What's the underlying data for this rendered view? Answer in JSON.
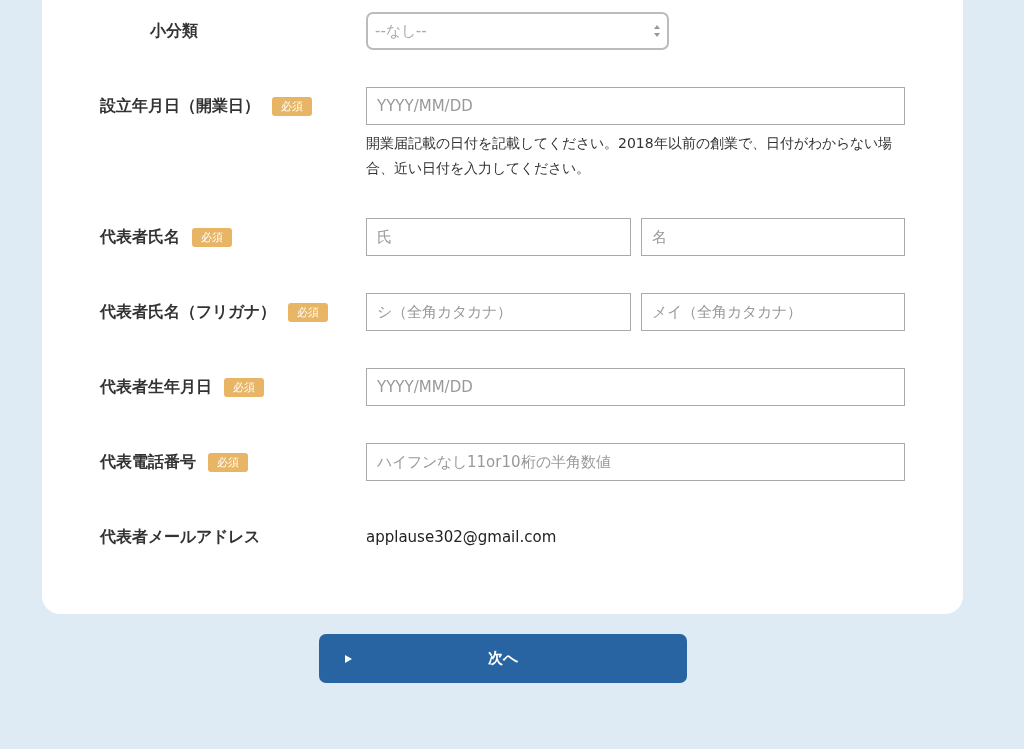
{
  "form": {
    "rows": [
      {
        "kind": "select",
        "label": "小分類",
        "value": "--なし--"
      },
      {
        "kind": "text",
        "label": "設立年月日（開業日）",
        "badge": "必須",
        "placeholder": "YYYY/MM/DD",
        "help": "開業届記載の日付を記載してください。2018年以前の創業で、日付がわからない場合、近い日付を入力してください。"
      },
      {
        "kind": "pair",
        "label": "代表者氏名",
        "badge": "必須",
        "placeholders": [
          "氏",
          "名"
        ]
      },
      {
        "kind": "pair",
        "label": "代表者氏名（フリガナ）",
        "badge": "必須",
        "placeholders": [
          "シ（全角カタカナ）",
          "メイ（全角カタカナ）"
        ]
      },
      {
        "kind": "text",
        "label": "代表者生年月日",
        "badge": "必須",
        "placeholder": "YYYY/MM/DD"
      },
      {
        "kind": "text",
        "label": "代表電話番号",
        "badge": "必須",
        "placeholder": "ハイフンなし11or10桁の半角数値"
      },
      {
        "kind": "static",
        "label": "代表者メールアドレス",
        "value": "applause302@gmail.com"
      }
    ]
  },
  "next_button": {
    "label": "次へ"
  }
}
